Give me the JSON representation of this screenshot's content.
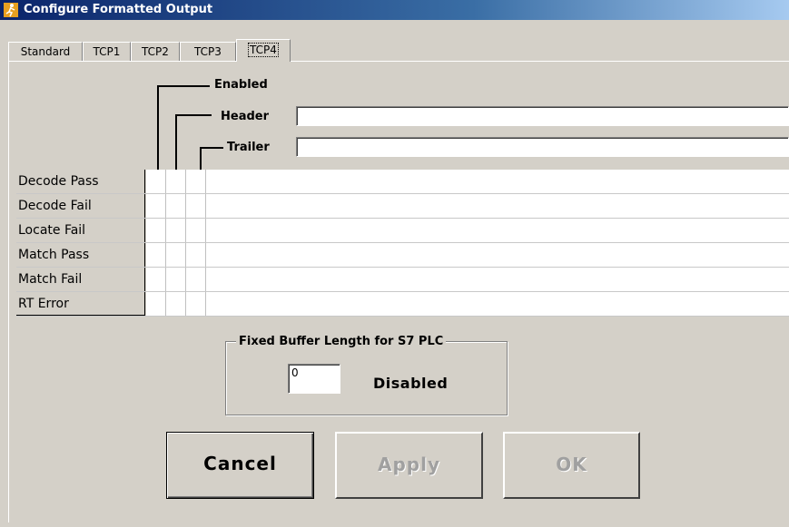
{
  "window": {
    "title": "Configure Formatted Output"
  },
  "tabs": [
    {
      "label": "Standard",
      "active": false
    },
    {
      "label": "TCP1",
      "active": false
    },
    {
      "label": "TCP2",
      "active": false
    },
    {
      "label": "TCP3",
      "active": false
    },
    {
      "label": "TCP4",
      "active": true
    }
  ],
  "columns": {
    "enabled": "Enabled",
    "header": "Header",
    "trailer": "Trailer"
  },
  "fields": {
    "header_value": "",
    "trailer_value": ""
  },
  "rows": [
    {
      "label": "Decode Pass"
    },
    {
      "label": "Decode Fail"
    },
    {
      "label": "Locate Fail"
    },
    {
      "label": "Match Pass"
    },
    {
      "label": "Match Fail"
    },
    {
      "label": "RT Error"
    }
  ],
  "buffer": {
    "title": "Fixed Buffer Length for S7 PLC",
    "value": "0",
    "status": "Disabled"
  },
  "buttons": {
    "cancel": "Cancel",
    "apply": "Apply",
    "ok": "OK"
  }
}
